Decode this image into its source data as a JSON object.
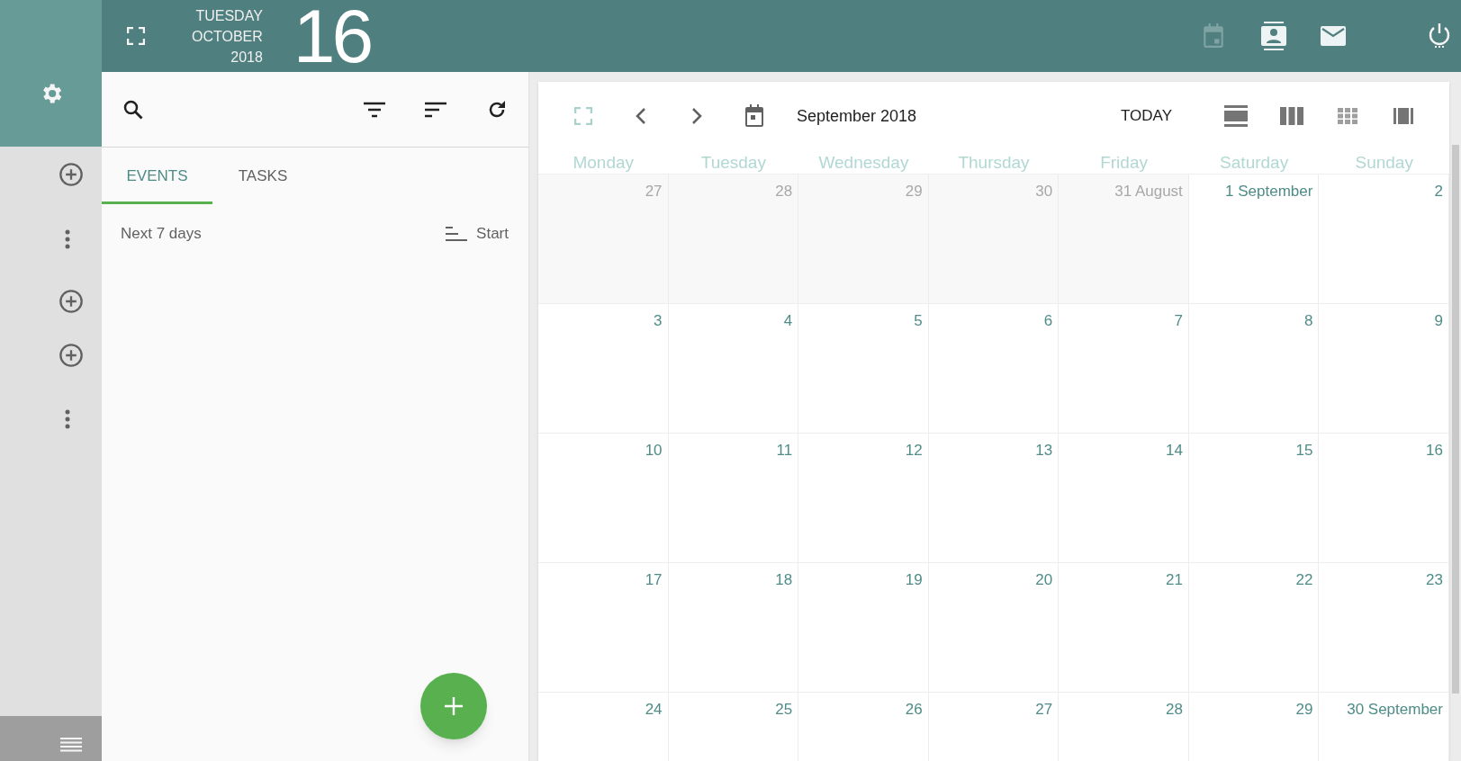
{
  "header": {
    "weekday": "TUESDAY",
    "month": "OCTOBER",
    "year": "2018",
    "day": "16"
  },
  "left_panel": {
    "tabs": [
      {
        "label": "EVENTS",
        "selected": true
      },
      {
        "label": "TASKS",
        "selected": false
      }
    ],
    "range_label": "Next 7 days",
    "sort_label": "Start"
  },
  "calendar": {
    "title": "September 2018",
    "today_button": "TODAY",
    "weekdays": [
      "Monday",
      "Tuesday",
      "Wednesday",
      "Thursday",
      "Friday",
      "Saturday",
      "Sunday"
    ],
    "weeks": [
      [
        {
          "label": "27",
          "other_month": true
        },
        {
          "label": "28",
          "other_month": true
        },
        {
          "label": "29",
          "other_month": true
        },
        {
          "label": "30",
          "other_month": true
        },
        {
          "label": "31 August",
          "other_month": true
        },
        {
          "label": "1 September",
          "other_month": false
        },
        {
          "label": "2",
          "other_month": false
        }
      ],
      [
        {
          "label": "3",
          "other_month": false
        },
        {
          "label": "4",
          "other_month": false
        },
        {
          "label": "5",
          "other_month": false
        },
        {
          "label": "6",
          "other_month": false
        },
        {
          "label": "7",
          "other_month": false
        },
        {
          "label": "8",
          "other_month": false
        },
        {
          "label": "9",
          "other_month": false
        }
      ],
      [
        {
          "label": "10",
          "other_month": false
        },
        {
          "label": "11",
          "other_month": false
        },
        {
          "label": "12",
          "other_month": false
        },
        {
          "label": "13",
          "other_month": false
        },
        {
          "label": "14",
          "other_month": false
        },
        {
          "label": "15",
          "other_month": false
        },
        {
          "label": "16",
          "other_month": false
        }
      ],
      [
        {
          "label": "17",
          "other_month": false
        },
        {
          "label": "18",
          "other_month": false
        },
        {
          "label": "19",
          "other_month": false
        },
        {
          "label": "20",
          "other_month": false
        },
        {
          "label": "21",
          "other_month": false
        },
        {
          "label": "22",
          "other_month": false
        },
        {
          "label": "23",
          "other_month": false
        }
      ],
      [
        {
          "label": "24",
          "other_month": false
        },
        {
          "label": "25",
          "other_month": false
        },
        {
          "label": "26",
          "other_month": false
        },
        {
          "label": "27",
          "other_month": false
        },
        {
          "label": "28",
          "other_month": false
        },
        {
          "label": "29",
          "other_month": false
        },
        {
          "label": "30 September",
          "other_month": false
        }
      ]
    ]
  }
}
